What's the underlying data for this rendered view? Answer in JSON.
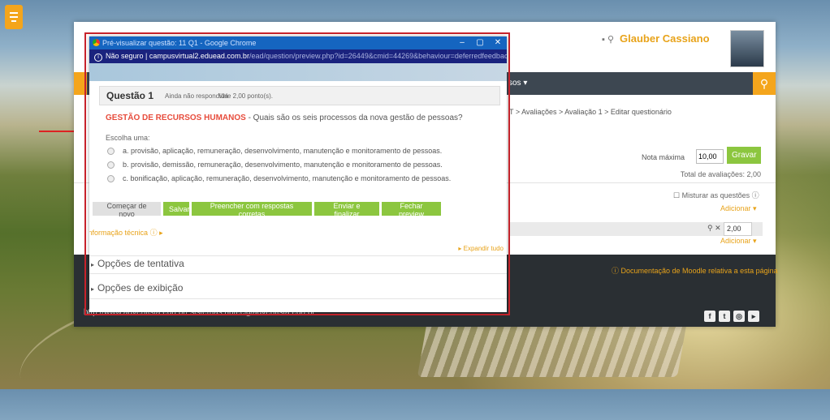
{
  "browser_popup": {
    "window_title": "Pré-visualizar questão: 11 Q1 - Google Chrome",
    "security_label": "Não seguro",
    "url_host": "campusvirtual2.eduead.com.br",
    "url_path": "/ead/question/preview.php?id=26449&cmid=44269&behaviour=deferredfeedback&maxmark=2.00...",
    "window_controls": [
      "–",
      "▢",
      "✕"
    ]
  },
  "question": {
    "title": "Questão 1",
    "status": "Ainda não respondida",
    "value": "Vale 2,00 ponto(s).",
    "subject": "GESTÃO DE RECURSOS HUMANOS",
    "prompt": " - Quais são os seis processos da nova gestão de pessoas?",
    "choose_label": "Escolha uma:",
    "options": [
      "a. provisão, aplicação, remuneração, desenvolvimento, manutenção e monitoramento de pessoas.",
      "b. provisão, demissão, remuneração, desenvolvimento, manutenção e monitoramento de pessoas.",
      "c. bonificação, aplicação, remuneração, desenvolvimento, manutenção e monitoramento de pessoas."
    ],
    "buttons": {
      "start_over": "Começar de novo",
      "save": "Salvar",
      "fill_correct": "Preencher com respostas corretas",
      "submit": "Enviar e finalizar",
      "close_preview": "Fechar preview"
    },
    "tech_info": "Informação técnica",
    "expand_all": "Expandir tudo",
    "sections": [
      "Opções de tentativa",
      "Opções de exibição"
    ]
  },
  "moodle": {
    "user_name": "Glauber Cassiano",
    "nav_label": "sos ▾",
    "breadcrumb": "T > Avaliações > Avaliação 1 > Editar questionário",
    "nota_label": "Nota máxima",
    "nota_value": "10,00",
    "save_button": "Gravar",
    "total": "Total de avaliações: 2,00",
    "shuffle_label": "Misturar as questões",
    "add_label": "Adicionar ▾",
    "question_grade": "2,00",
    "doc_link": "Documentação de Moodle relativa a esta página",
    "footer_contacts": "http://www.adventista.edu.br/      sistemas.nutec@adventista.edu.br"
  },
  "colors": {
    "accent": "#f4a51c",
    "green": "#8cc63f",
    "highlight": "#c8232b",
    "chrome_blue": "#1565c0"
  }
}
